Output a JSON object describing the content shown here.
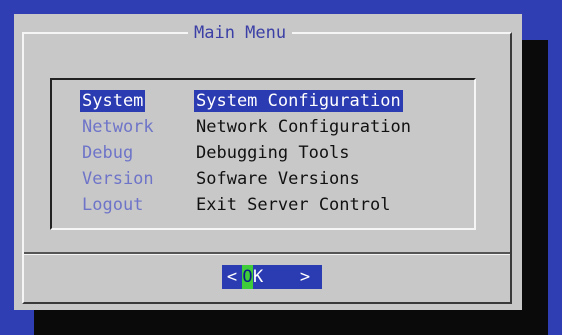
{
  "dialog": {
    "title": "Main Menu"
  },
  "menu": {
    "items": [
      {
        "tag": "System",
        "description": "System Configuration",
        "selected": true
      },
      {
        "tag": "Network",
        "description": "Network Configuration",
        "selected": false
      },
      {
        "tag": "Debug",
        "description": "Debugging Tools",
        "selected": false
      },
      {
        "tag": "Version",
        "description": "Sofware Versions",
        "selected": false
      },
      {
        "tag": "Logout",
        "description": "Exit Server Control",
        "selected": false
      }
    ]
  },
  "ok_button": {
    "left_bracket": "<",
    "hotkey": "O",
    "rest": "K",
    "right_bracket": ">"
  },
  "colors": {
    "background": "#2f3fb3",
    "dialog": "#c8c8c8",
    "selection": "#2b3bb1",
    "hotkey": "#3fcc3a",
    "tag_text": "#6e74c8"
  }
}
